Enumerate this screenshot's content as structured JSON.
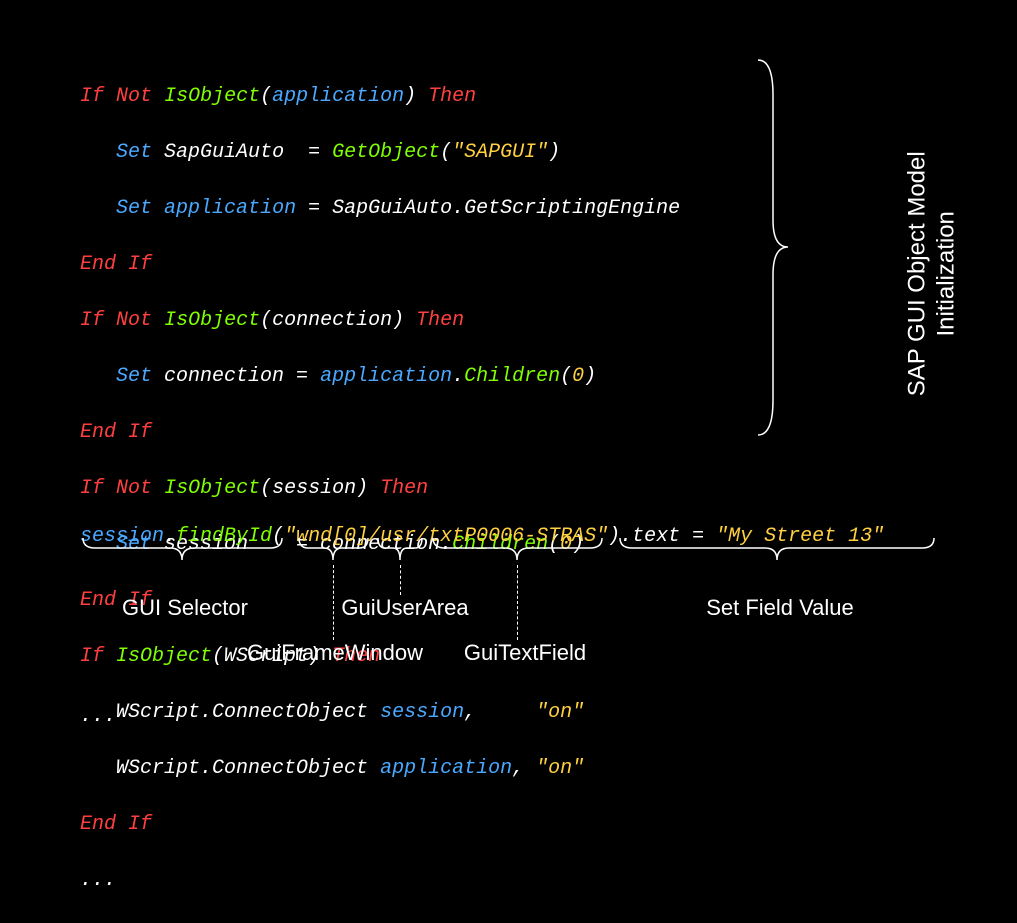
{
  "code": {
    "l1": {
      "t1": "If",
      "t2": "Not",
      "t3": "IsObject",
      "t4": "(",
      "t5": "application",
      "t6": ") ",
      "t7": "Then"
    },
    "l2": {
      "t1": "Set",
      "t2": "SapGuiAuto  = ",
      "t3": "GetObject",
      "t4": "(",
      "t5": "\"SAPGUI\"",
      "t6": ")"
    },
    "l3": {
      "t1": "Set",
      "t2": "application",
      "t3": " = SapGuiAuto.GetScriptingEngine"
    },
    "l4": {
      "t1": "End",
      "t2": "If"
    },
    "l5": {
      "t1": "If",
      "t2": "Not",
      "t3": "IsObject",
      "t4": "(connection) ",
      "t5": "Then"
    },
    "l6": {
      "t1": "Set",
      "t2": " connection = ",
      "t3": "application",
      "t4": ".",
      "t5": "Children",
      "t6": "(",
      "t7": "0",
      "t8": ")"
    },
    "l7": {
      "t1": "End",
      "t2": "If"
    },
    "l8": {
      "t1": "If",
      "t2": "Not",
      "t3": "IsObject",
      "t4": "(session) ",
      "t5": "Then"
    },
    "l9": {
      "t1": "Set",
      "t2": " session    = connection.",
      "t3": "Children",
      "t4": "(",
      "t5": "0",
      "t6": ")"
    },
    "l10": {
      "t1": "End",
      "t2": "If"
    },
    "l11": {
      "t1": "If",
      "t2": "IsObject",
      "t3": "(WScript) ",
      "t4": "Then"
    },
    "l12": {
      "t1": "WScript.ConnectObject ",
      "t2": "session",
      "t3": ",     ",
      "t4": "\"on\""
    },
    "l13": {
      "t1": "WScript.ConnectObject ",
      "t2": "application",
      "t3": ", ",
      "t4": "\"on\""
    },
    "l14": {
      "t1": "End",
      "t2": "If"
    },
    "l15": "..."
  },
  "side_label_line1": "SAP GUI Object Model",
  "side_label_line2": "Initialization",
  "stmt": {
    "t1": "session",
    "t2": ".",
    "t3": "findById",
    "t4": "(",
    "t5": "\"wnd[0]/usr/txtP0006-STRAS\"",
    "t6": ").text = ",
    "t7": "\"My Street 13\""
  },
  "labels": {
    "gui_selector": "GUI Selector",
    "gui_frame": "GuiFrameWindow",
    "gui_user": "GuiUserArea",
    "gui_text": "GuiTextField",
    "set_field": "Set Field Value"
  },
  "ellipsis": "..."
}
